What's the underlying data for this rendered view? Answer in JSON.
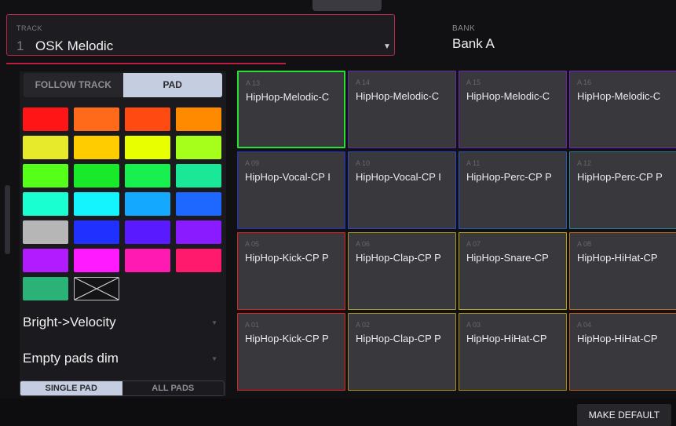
{
  "track": {
    "label": "TRACK",
    "number": "1",
    "name": "OSK Melodic"
  },
  "bank": {
    "label": "BANK",
    "name": "Bank A"
  },
  "color_mode": {
    "options": [
      "FOLLOW TRACK",
      "PAD"
    ],
    "selected": "PAD"
  },
  "swatches": [
    [
      "#ff1515",
      "#ff6a1a",
      "#ff4a12",
      "#ff8a00"
    ],
    [
      "#e6ea2a",
      "#ffcc00",
      "#e8ff00",
      "#a6ff1a"
    ],
    [
      "#55ff1a",
      "#18ea2a",
      "#18f050",
      "#1ae898"
    ],
    [
      "#1affd2",
      "#13f4ff",
      "#14a8ff",
      "#1e68ff"
    ],
    [
      "#b6b6b6",
      "#2030ff",
      "#5a1aff",
      "#8a1aff"
    ],
    [
      "#b21aff",
      "#ff1aff",
      "#ff1ab2",
      "#ff1a6e"
    ],
    [
      "#2bb276",
      "none"
    ]
  ],
  "dropdowns": [
    {
      "value": "Bright->Velocity"
    },
    {
      "value": "Empty pads dim"
    }
  ],
  "pad_mode": {
    "options": [
      "SINGLE PAD",
      "ALL PADS"
    ],
    "selected": "SINGLE PAD"
  },
  "pads": [
    {
      "id": "A 13",
      "name": "HipHop-Melodic-C",
      "color": "#28e034",
      "selected": true
    },
    {
      "id": "A 14",
      "name": "HipHop-Melodic-C",
      "color": "#5a2ea0"
    },
    {
      "id": "A 15",
      "name": "HipHop-Melodic-C",
      "color": "#6a28a8"
    },
    {
      "id": "A 16",
      "name": "HipHop-Melodic-C",
      "color": "#7a20c8"
    },
    {
      "id": "A 09",
      "name": "HipHop-Vocal-CP I",
      "color": "#2030c8"
    },
    {
      "id": "A 10",
      "name": "HipHop-Vocal-CP I",
      "color": "#2a44d0"
    },
    {
      "id": "A 11",
      "name": "HipHop-Perc-CP P",
      "color": "#2a58b4"
    },
    {
      "id": "A 12",
      "name": "HipHop-Perc-CP P",
      "color": "#2c8296"
    },
    {
      "id": "A 05",
      "name": "HipHop-Kick-CP P",
      "color": "#e02020"
    },
    {
      "id": "A 06",
      "name": "HipHop-Clap-CP P",
      "color": "#a8961e"
    },
    {
      "id": "A 07",
      "name": "HipHop-Snare-CP",
      "color": "#b6a81a"
    },
    {
      "id": "A 08",
      "name": "HipHop-HiHat-CP",
      "color": "#c2641a"
    },
    {
      "id": "A 01",
      "name": "HipHop-Kick-CP P",
      "color": "#e02020"
    },
    {
      "id": "A 02",
      "name": "HipHop-Clap-CP P",
      "color": "#a08c20"
    },
    {
      "id": "A 03",
      "name": "HipHop-HiHat-CP",
      "color": "#a88c1a"
    },
    {
      "id": "A 04",
      "name": "HipHop-HiHat-CP",
      "color": "#b45a1a"
    }
  ],
  "footer": {
    "make_default_label": "MAKE DEFAULT"
  }
}
